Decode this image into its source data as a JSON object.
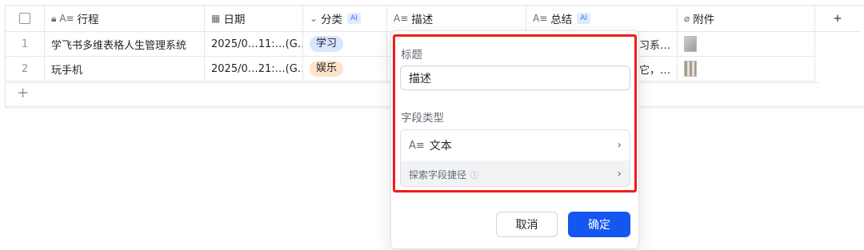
{
  "table": {
    "columns": [
      {
        "icon": "lock-text-icon",
        "label": "行程",
        "ai": false
      },
      {
        "icon": "calendar-icon",
        "label": "日期",
        "ai": false
      },
      {
        "icon": "select-icon",
        "label": "分类",
        "ai": true
      },
      {
        "icon": "text-icon",
        "label": "描述",
        "ai": false
      },
      {
        "icon": "text-icon",
        "label": "总结",
        "ai": true
      },
      {
        "icon": "paperclip-icon",
        "label": "附件",
        "ai": false
      }
    ],
    "ai_badge": "AI",
    "add_column_symbol": "+",
    "add_row_symbol": "+",
    "rows": [
      {
        "index": "1",
        "title": "学飞书多维表格人生管理系统",
        "date": "2025/0…11:…(G…",
        "category": "学习",
        "summary": "习系…"
      },
      {
        "index": "2",
        "title": "玩手机",
        "date": "2025/0…21:…(G…",
        "category": "娱乐",
        "summary": "它，…"
      }
    ]
  },
  "field_panel": {
    "title_label": "标题",
    "title_value": "描述",
    "type_label": "字段类型",
    "type_icon_text": "A≡",
    "type_value": "文本",
    "explore_label": "探索字段捷径",
    "info_symbol": "ⓘ",
    "chevron": "›",
    "cancel_label": "取消",
    "confirm_label": "确定"
  },
  "colors": {
    "accent": "#1456f0",
    "highlight_border": "#f01c1c",
    "tag_study": "#d9e6ff",
    "tag_fun": "#fde3c9"
  }
}
